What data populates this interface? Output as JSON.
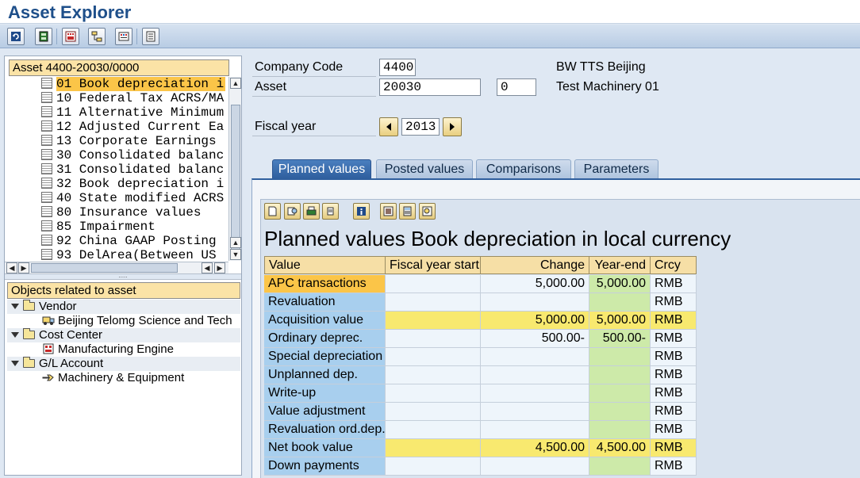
{
  "app": {
    "title": "Asset Explorer"
  },
  "toolbar": {
    "buttons": [
      "refresh-icon",
      "switch-icon",
      "calculate-icon",
      "hierarchy-icon",
      "display-icon",
      "list-icon"
    ]
  },
  "tree": {
    "header": "Asset 4400-20030/0000",
    "items": [
      {
        "label": "01 Book depreciation i"
      },
      {
        "label": "10 Federal Tax ACRS/MA"
      },
      {
        "label": "11 Alternative Minimum"
      },
      {
        "label": "12 Adjusted Current Ea"
      },
      {
        "label": "13 Corporate Earnings"
      },
      {
        "label": "30 Consolidated balanc"
      },
      {
        "label": "31 Consolidated balanc"
      },
      {
        "label": "32 Book depreciation i"
      },
      {
        "label": "40 State modified ACRS"
      },
      {
        "label": "80 Insurance values"
      },
      {
        "label": "85 Impairment"
      },
      {
        "label": "92 China GAAP Posting"
      },
      {
        "label": "93 DelArea(Between US"
      }
    ]
  },
  "objects": {
    "header": "Objects related to asset",
    "vendor_label": "Vendor",
    "vendor_item": "Beijing Telomg Science and Tech",
    "costcenter_label": "Cost Center",
    "costcenter_item": "Manufacturing Engine",
    "gl_label": "G/L Account",
    "gl_item": "Machinery & Equipment"
  },
  "header_fields": {
    "company_code_label": "Company Code",
    "company_code_value": "4400",
    "company_name": "BW TTS Beijing",
    "asset_label": "Asset",
    "asset_value": "20030",
    "asset_sub": "0",
    "asset_desc": "Test Machinery 01",
    "fiscal_year_label": "Fiscal year",
    "fiscal_year_value": "2013"
  },
  "tabs": [
    "Planned values",
    "Posted values",
    "Comparisons",
    "Parameters"
  ],
  "panel": {
    "title": "Planned values Book depreciation in local currency",
    "columns": [
      "Value",
      "Fiscal year start",
      "Change",
      "Year-end",
      "Crcy"
    ],
    "rows": [
      {
        "value": "APC transactions",
        "start": "",
        "change": "5,000.00",
        "end": "5,000.00",
        "crcy": "RMB"
      },
      {
        "value": "Revaluation",
        "start": "",
        "change": "",
        "end": "",
        "crcy": "RMB"
      },
      {
        "value": "Acquisition value",
        "start": "",
        "change": "5,000.00",
        "end": "5,000.00",
        "crcy": "RMB"
      },
      {
        "value": "Ordinary deprec.",
        "start": "",
        "change": "500.00-",
        "end": "500.00-",
        "crcy": "RMB"
      },
      {
        "value": "Special depreciation",
        "start": "",
        "change": "",
        "end": "",
        "crcy": "RMB"
      },
      {
        "value": "Unplanned dep.",
        "start": "",
        "change": "",
        "end": "",
        "crcy": "RMB"
      },
      {
        "value": "Write-up",
        "start": "",
        "change": "",
        "end": "",
        "crcy": "RMB"
      },
      {
        "value": "Value adjustment",
        "start": "",
        "change": "",
        "end": "",
        "crcy": "RMB"
      },
      {
        "value": "Revaluation ord.dep.",
        "start": "",
        "change": "",
        "end": "",
        "crcy": "RMB"
      },
      {
        "value": "Net book value",
        "start": "",
        "change": "4,500.00",
        "end": "4,500.00",
        "crcy": "RMB"
      },
      {
        "value": "Down payments",
        "start": "",
        "change": "",
        "end": "",
        "crcy": "RMB"
      }
    ]
  }
}
